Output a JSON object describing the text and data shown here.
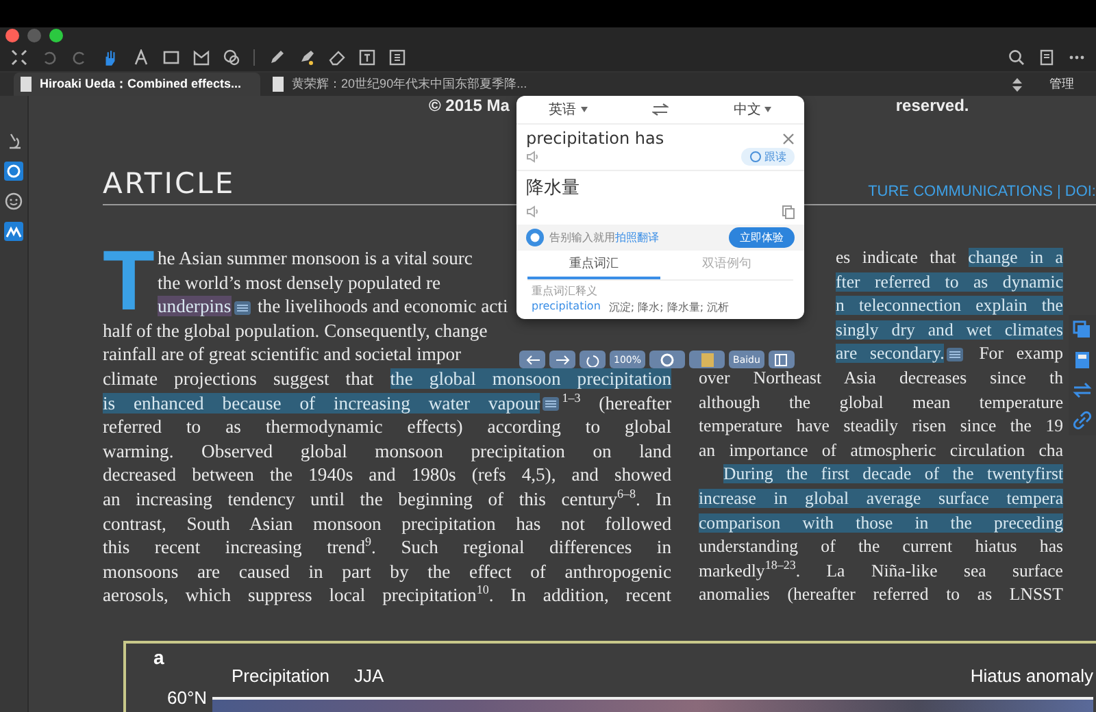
{
  "tabs": [
    {
      "title": "Hiroaki Ueda：Combined effects...",
      "selected": true
    },
    {
      "title": "黄荣辉：20世纪90年代末中国东部夏季降...",
      "selected": false
    }
  ],
  "manage_label": "管理",
  "document": {
    "copyright_left": "© 2015 Ma",
    "copyright_right": "reserved.",
    "section_title": "ARTICLE",
    "journal_header": "TURE COMMUNICATIONS | DOI:",
    "drop_cap": "T",
    "left_column": [
      {
        "kind": "line",
        "segments": [
          {
            "text": "he Asian summer monsoon is a vital sourc",
            "highlighted": false,
            "note": false
          }
        ]
      },
      {
        "kind": "line",
        "segments": [
          {
            "text": "the world’s most densely populated re",
            "highlighted": false,
            "note": false
          }
        ]
      },
      {
        "kind": "line",
        "segments": [
          {
            "text": "underpins",
            "highlighted": true,
            "color": "#5a4a66",
            "note": true
          },
          {
            "text": " the livelihoods and economic acti",
            "highlighted": false,
            "note": false
          }
        ]
      },
      {
        "kind": "line",
        "segments": [
          {
            "text": "half of the global population. Consequently, change",
            "highlighted": false,
            "note": false
          }
        ]
      },
      {
        "kind": "line",
        "segments": [
          {
            "text": "rainfall are of great scientific and societal impor",
            "highlighted": false,
            "note": false
          }
        ]
      },
      {
        "kind": "line",
        "segments": [
          {
            "text": "climate projections suggest that ",
            "highlighted": false,
            "note": false
          },
          {
            "text": "the global monsoon precipitation",
            "highlighted": true,
            "color": "#2f5f7a",
            "note": false
          }
        ]
      },
      {
        "kind": "line",
        "segments": [
          {
            "text": "is enhanced because of increasing water vapour",
            "highlighted": true,
            "color": "#2f5f7a",
            "note": true
          },
          {
            "text": "$^{1–3}$ (hereafter",
            "highlighted": false,
            "note": false
          }
        ]
      },
      {
        "kind": "line",
        "segments": [
          {
            "text": "referred to as thermodynamic effects) according to global",
            "highlighted": false,
            "note": false
          }
        ]
      },
      {
        "kind": "line",
        "segments": [
          {
            "text": "warming. Observed global monsoon precipitation on land",
            "highlighted": false,
            "note": false
          }
        ]
      },
      {
        "kind": "line",
        "segments": [
          {
            "text": "decreased between the 1940s and 1980s (refs 4,5), and showed",
            "highlighted": false,
            "note": false
          }
        ]
      },
      {
        "kind": "line",
        "segments": [
          {
            "text": "an increasing tendency until the beginning of this century$^{6–8}$. In",
            "highlighted": false,
            "note": false
          }
        ]
      },
      {
        "kind": "line",
        "segments": [
          {
            "text": "contrast, South Asian monsoon precipitation has not followed",
            "highlighted": false,
            "note": false
          }
        ]
      },
      {
        "kind": "line",
        "segments": [
          {
            "text": "this recent increasing trend$^{9}$. Such regional differences in",
            "highlighted": false,
            "note": false
          }
        ]
      },
      {
        "kind": "line",
        "segments": [
          {
            "text": "monsoons are caused in part by the effect of anthropogenic",
            "highlighted": false,
            "note": false
          }
        ]
      },
      {
        "kind": "line",
        "segments": [
          {
            "text": "aerosols, which suppress local precipitation$^{10}$. In addition, recent",
            "highlighted": false,
            "note": false
          }
        ]
      }
    ],
    "right_column": [
      {
        "kind": "line",
        "segments": [
          {
            "text": "es indicate that ",
            "highlighted": false,
            "note": false
          },
          {
            "text": "change in a",
            "highlighted": true,
            "color": "#2f5f7a",
            "note": false
          }
        ]
      },
      {
        "kind": "line",
        "segments": [
          {
            "text": "fter referred to as dynamic",
            "highlighted": true,
            "color": "#2f5f7a",
            "note": false
          }
        ]
      },
      {
        "kind": "line",
        "segments": [
          {
            "text": "n teleconnection explain the",
            "highlighted": true,
            "color": "#2f5f7a",
            "note": false
          }
        ]
      },
      {
        "kind": "line",
        "segments": [
          {
            "text": "singly dry and wet climates",
            "highlighted": true,
            "color": "#2f5f7a",
            "note": false
          }
        ]
      },
      {
        "kind": "line",
        "segments": [
          {
            "text": "are secondary.",
            "highlighted": true,
            "color": "#2f5f7a",
            "note": true
          },
          {
            "text": " For examp",
            "highlighted": false,
            "note": false
          }
        ]
      },
      {
        "kind": "line",
        "segments": [
          {
            "text": "over Northeast Asia decreases since th",
            "highlighted": false,
            "note": false
          }
        ]
      },
      {
        "kind": "line",
        "segments": [
          {
            "text": "although the global mean temperature",
            "highlighted": false,
            "note": false
          }
        ]
      },
      {
        "kind": "line",
        "segments": [
          {
            "text": "temperature have steadily risen since the 19",
            "highlighted": false,
            "note": false
          }
        ]
      },
      {
        "kind": "line",
        "segments": [
          {
            "text": "an importance of atmospheric circulation cha",
            "highlighted": false,
            "note": false
          }
        ]
      },
      {
        "kind": "paragraph_start",
        "segments": [
          {
            "text": "During the first decade of the twentyfirst",
            "highlighted": true,
            "color": "#2f5f7a",
            "note": false
          }
        ]
      },
      {
        "kind": "line",
        "segments": [
          {
            "text": "increase in global average surface tempera",
            "highlighted": true,
            "color": "#2f5f7a",
            "note": false
          }
        ]
      },
      {
        "kind": "line",
        "segments": [
          {
            "text": "comparison with those in the preceding",
            "highlighted": true,
            "color": "#2f5f7a",
            "note": false
          }
        ]
      },
      {
        "kind": "line",
        "segments": [
          {
            "text": "understanding of the current hiatus has",
            "highlighted": false,
            "note": false
          }
        ]
      },
      {
        "kind": "line",
        "segments": [
          {
            "text": "markedly$^{18–23}$. La Niña-like sea surface",
            "highlighted": false,
            "note": false
          }
        ]
      },
      {
        "kind": "line",
        "segments": [
          {
            "text": "anomalies (hereafter referred to as LNSST",
            "highlighted": false,
            "note": false
          }
        ]
      }
    ],
    "figure": {
      "panel_label": "a",
      "title": "Precipitation",
      "season": "JJA",
      "right_title": "Hiatus anomaly",
      "lat_label": "60°N"
    }
  },
  "translator": {
    "source_lang": "英语",
    "target_lang": "中文",
    "source_text": "precipitation has",
    "read_along_label": "跟读",
    "result_text": "降水量",
    "promo": {
      "text": "告别输入就用",
      "link": "拍照翻译",
      "button": "立即体验"
    },
    "tabs": [
      {
        "label": "重点词汇",
        "selected": true
      },
      {
        "label": "双语例句",
        "selected": false
      }
    ],
    "section_title": "重点词汇释义",
    "entry": {
      "word": "precipitation",
      "meaning": "沉淀; 降水; 降水量; 沉析"
    },
    "zoom": "100%",
    "engine": "Baidu"
  }
}
